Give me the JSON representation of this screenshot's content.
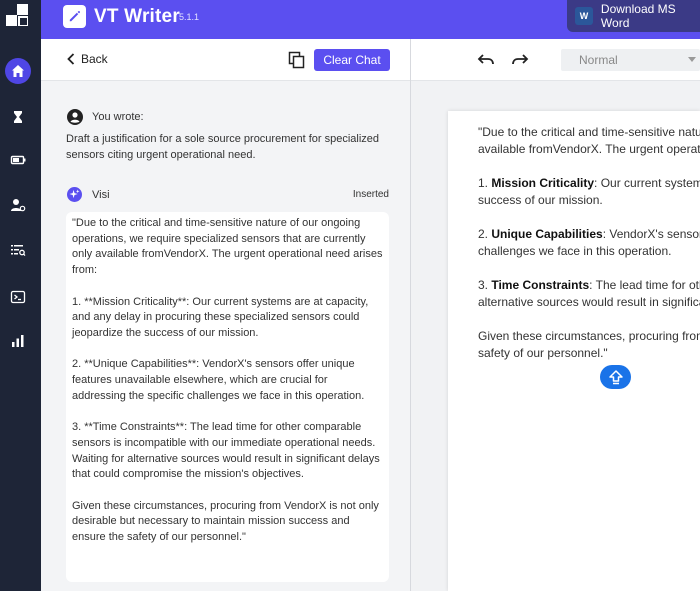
{
  "app": {
    "title": "VT Writer",
    "version": "5.1.1",
    "download_label": "Download MS Word",
    "word_icon_letter": "W"
  },
  "colors": {
    "brand": "#5b4ff0",
    "rail": "#1e2537",
    "active_nav": "#4f46e5",
    "fab": "#1a73e8"
  },
  "rail": {
    "items": [
      {
        "icon": "home-icon",
        "active": true
      },
      {
        "icon": "hourglass-icon",
        "active": false
      },
      {
        "icon": "battery-icon",
        "active": false
      },
      {
        "icon": "user-settings-icon",
        "active": false
      },
      {
        "icon": "list-search-icon",
        "active": false
      },
      {
        "icon": "terminal-icon",
        "active": false
      },
      {
        "icon": "bar-chart-icon",
        "active": false
      }
    ]
  },
  "chat": {
    "back_label": "Back",
    "clear_label": "Clear Chat",
    "you_label": "You wrote:",
    "prompt": "Draft a justification for a sole source procurement for specialized sensors citing urgent operational need.",
    "assistant_name": "Visi",
    "status_badge": "Inserted",
    "response": [
      "\"Due to the critical and time-sensitive nature of our ongoing operations, we require specialized sensors that are currently only available fromVendorX. The urgent operational need arises from:",
      "1. **Mission Criticality**: Our current systems are at capacity, and any delay in procuring these specialized sensors could jeopardize the success of our mission.",
      "2. **Unique Capabilities**: VendorX's sensors offer unique features unavailable elsewhere, which are crucial for addressing the specific challenges we face in this operation.",
      "3. **Time Constraints**: The lead time for other comparable sensors is incompatible with our immediate operational needs. Waiting for alternative sources would result in significant delays that could compromise the mission's objectives.",
      "Given these circumstances, procuring from VendorX is not only desirable but necessary to maintain mission success and ensure the safety of our personnel.\""
    ]
  },
  "editor": {
    "style_value": "Normal",
    "doc": {
      "p1_l1": "\"Due to the critical and time-sensitive nature of our ongoing",
      "p1_l2": "available fromVendorX. The urgent operational need arises from:",
      "p2_title": "Mission Criticality",
      "p2_l1_rest": ": Our current systems are at capacity, and any",
      "p2_l2": "success of our mission.",
      "p3_title": "Unique Capabilities",
      "p3_l1_rest": ": VendorX's sensors offer unique features",
      "p3_l2": "challenges we face in this operation.",
      "p4_title": "Time Constraints",
      "p4_l1_rest": ": The lead time for other comparable",
      "p4_l2": "alternative sources would result in significant delays",
      "p5_l1": "Given these circumstances, procuring from VendorX is",
      "p5_l2": "safety of our personnel.\"",
      "n1": "1. ",
      "n2": "2. ",
      "n3": "3. "
    }
  }
}
